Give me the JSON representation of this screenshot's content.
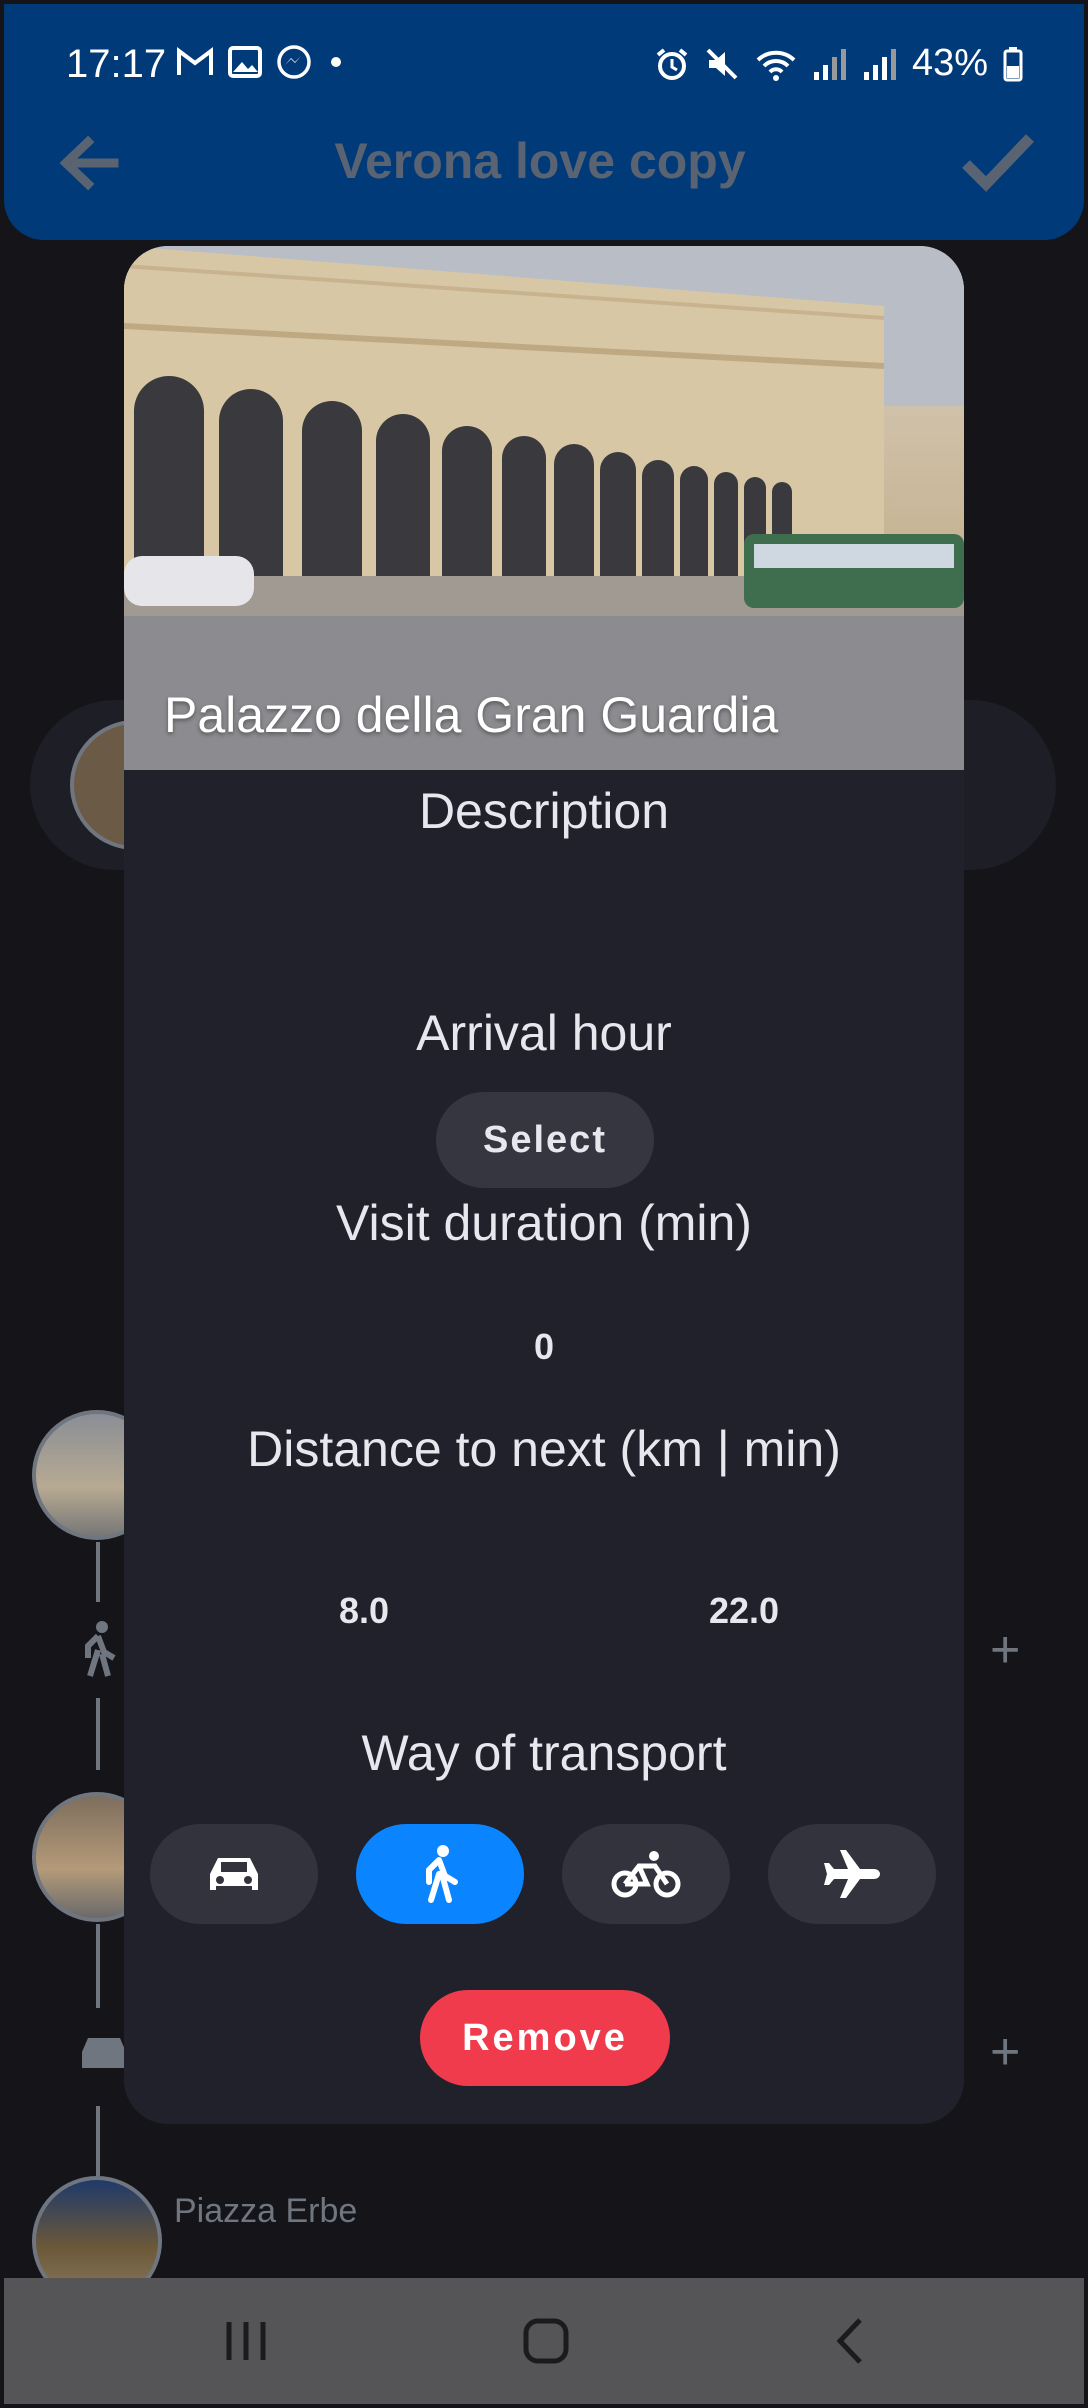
{
  "status_bar": {
    "time": "17:17",
    "battery": "43%",
    "left_icons": [
      "gmail-icon",
      "gallery-icon",
      "messenger-icon",
      "dot-icon"
    ],
    "right_icons": [
      "alarm-icon",
      "mute-icon",
      "wifi-icon",
      "signal-icon",
      "signal-icon",
      "battery-icon"
    ]
  },
  "toolbar": {
    "title": "Verona love copy",
    "back_icon": "arrow-back-icon",
    "save_icon": "check-icon"
  },
  "background_list": {
    "visible_place_label": "Piazza Erbe",
    "add_symbol": "+"
  },
  "dialog": {
    "place_name": "Palazzo della Gran Guardia",
    "description_heading": "Description",
    "arrival_heading": "Arrival hour",
    "select_label": "Select",
    "visit_duration_heading": "Visit duration (min)",
    "visit_duration_value": "0",
    "distance_heading": "Distance to next (km | min)",
    "distance_km": "8.0",
    "distance_min": "22.0",
    "transport_heading": "Way of transport",
    "transport_options": [
      {
        "icon": "car-icon",
        "selected": false
      },
      {
        "icon": "walking-icon",
        "selected": true
      },
      {
        "icon": "bicycle-icon",
        "selected": false
      },
      {
        "icon": "airplane-icon",
        "selected": false
      }
    ],
    "remove_label": "Remove"
  },
  "colors": {
    "header": "#003a78",
    "dialog_bg": "#20212b",
    "accent": "#0a84ff",
    "danger": "#ef3b4c"
  }
}
